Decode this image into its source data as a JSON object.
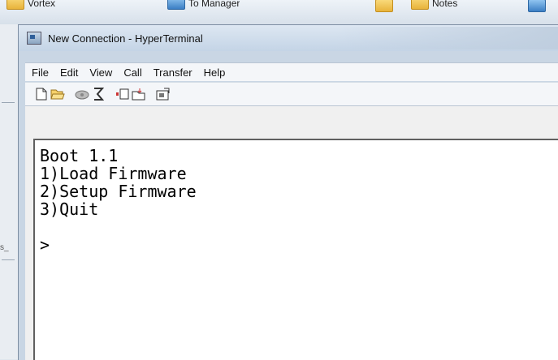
{
  "background": {
    "items": [
      {
        "label": "Vortex"
      },
      {
        "label": "To Manager"
      },
      {
        "label": "Notes"
      }
    ],
    "left_mark": "s_"
  },
  "window": {
    "title": "New Connection - HyperTerminal"
  },
  "menu": {
    "items": [
      "File",
      "Edit",
      "View",
      "Call",
      "Transfer",
      "Help"
    ]
  },
  "toolbar": {
    "icons": [
      "new-icon",
      "open-icon",
      "disconnect-icon",
      "call-icon",
      "send-icon",
      "receive-icon",
      "properties-icon"
    ]
  },
  "terminal": {
    "lines": [
      "Boot 1.1",
      "1)Load Firmware",
      "2)Setup Firmware",
      "3)Quit"
    ],
    "prompt": ">"
  }
}
